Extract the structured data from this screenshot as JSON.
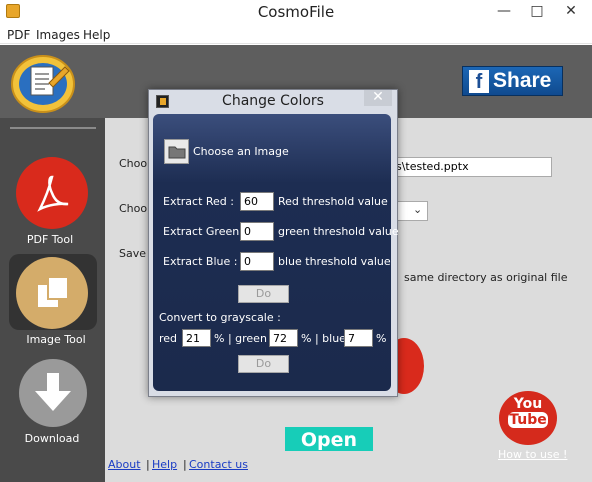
{
  "window": {
    "title": "CosmoFile",
    "minimize_glyph": "—",
    "maximize_glyph": "□",
    "close_glyph": "✕"
  },
  "menu": {
    "items": [
      "PDF",
      "Images",
      "Help"
    ]
  },
  "share": {
    "label": "Share",
    "icon": "facebook-icon"
  },
  "sidebar": {
    "items": [
      {
        "label": "PDF Tool",
        "icon": "pdf-icon"
      },
      {
        "label": "Image Tool",
        "icon": "copy-icon"
      },
      {
        "label": "Download",
        "icon": "download-arrow-icon"
      }
    ]
  },
  "main": {
    "choose_1": "Choo",
    "choose_2": "Choo",
    "save": "Save",
    "path_value": "s\\tested.pptx",
    "same_dir": "same directory as original file",
    "open_label": "Open",
    "how_to_use": "How to use !",
    "youtube": {
      "top": "You",
      "bottom": "Tube"
    }
  },
  "footer": {
    "about": "About",
    "help": "Help",
    "contact": "Contact us"
  },
  "dialog": {
    "title": "Change Colors",
    "close_glyph": "✕",
    "choose_image": "Choose an Image",
    "extract_red_label": "Extract Red :",
    "extract_red_value": "60",
    "red_threshold": "Red threshold value",
    "extract_green_label": "Extract Green :",
    "extract_green_value": "0",
    "green_threshold": "green threshold value",
    "extract_blue_label": "Extract Blue :",
    "extract_blue_value": "0",
    "blue_threshold": "blue threshold value",
    "do_label": "Do",
    "grayscale_title": "Convert to grayscale :",
    "gray_red_label": "red",
    "gray_red_value": "21",
    "gray_green_sep": "% | green",
    "gray_green_value": "72",
    "gray_blue_sep": "% | blue",
    "gray_blue_value": "7",
    "gray_pct": "%"
  },
  "colors": {
    "panel_dark": "#5e5e5e",
    "dialog_blue": "#1b2a4c",
    "open_teal": "#17cdb8",
    "pdf_red": "#d92a1c",
    "image_tan": "#d4ac6a",
    "share_blue": "#1c67b5"
  }
}
